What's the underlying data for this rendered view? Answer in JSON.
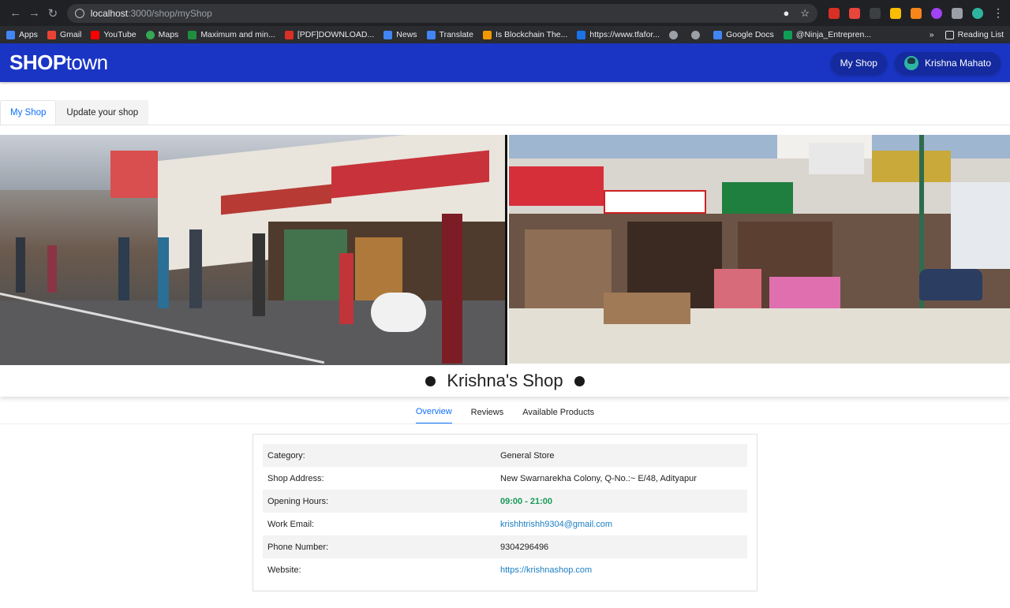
{
  "browser": {
    "url_host": "localhost",
    "url_path": ":3000/shop/myShop",
    "bookmarks": [
      {
        "label": "Apps",
        "color": "#4285f4"
      },
      {
        "label": "Gmail",
        "color": "#ea4335"
      },
      {
        "label": "YouTube",
        "color": "#ff0000"
      },
      {
        "label": "Maps",
        "color": "#34a853"
      },
      {
        "label": "Maximum and min...",
        "color": "#1e8e3e"
      },
      {
        "label": "[PDF]DOWNLOAD...",
        "color": "#d93025"
      },
      {
        "label": "News",
        "color": "#4285f4"
      },
      {
        "label": "Translate",
        "color": "#4285f4"
      },
      {
        "label": "Is Blockchain The...",
        "color": "#f29900"
      },
      {
        "label": "https://www.tfafor...",
        "color": "#1a73e8"
      },
      {
        "label": "",
        "color": "#9aa0a6"
      },
      {
        "label": "",
        "color": "#9aa0a6"
      },
      {
        "label": "Google Docs",
        "color": "#4285f4"
      },
      {
        "label": "@Ninja_Entrepren...",
        "color": "#0f9d58"
      }
    ],
    "more": "»",
    "reading_list": "Reading List"
  },
  "header": {
    "logo_bold": "SHOP",
    "logo_light": "town",
    "my_shop_button": "My Shop",
    "user_name": "Krishna Mahato"
  },
  "shop_tabs": [
    {
      "label": "My Shop",
      "active": true
    },
    {
      "label": "Update your shop",
      "active": false
    }
  ],
  "shop": {
    "name": "Krishna's Shop"
  },
  "section_tabs": [
    {
      "label": "Overview",
      "active": true
    },
    {
      "label": "Reviews",
      "active": false
    },
    {
      "label": "Available Products",
      "active": false
    }
  ],
  "details": [
    {
      "label": "Category:",
      "value": "General Store"
    },
    {
      "label": "Shop Address:",
      "value": "New Swarnarekha Colony, Q-No.:~ E/48, Adityapur"
    },
    {
      "label": "Opening Hours:",
      "value": "09:00 - 21:00"
    },
    {
      "label": "Work Email:",
      "value": "krishhtrishh9304@gmail.com"
    },
    {
      "label": "Phone Number:",
      "value": "9304296496"
    },
    {
      "label": "Website:",
      "value": "https://krishnashop.com"
    }
  ],
  "colors": {
    "header_bg": "#1a35c4",
    "accent": "#0d6efd",
    "hours_green": "#169b56",
    "link_blue": "#1b7ec2"
  }
}
